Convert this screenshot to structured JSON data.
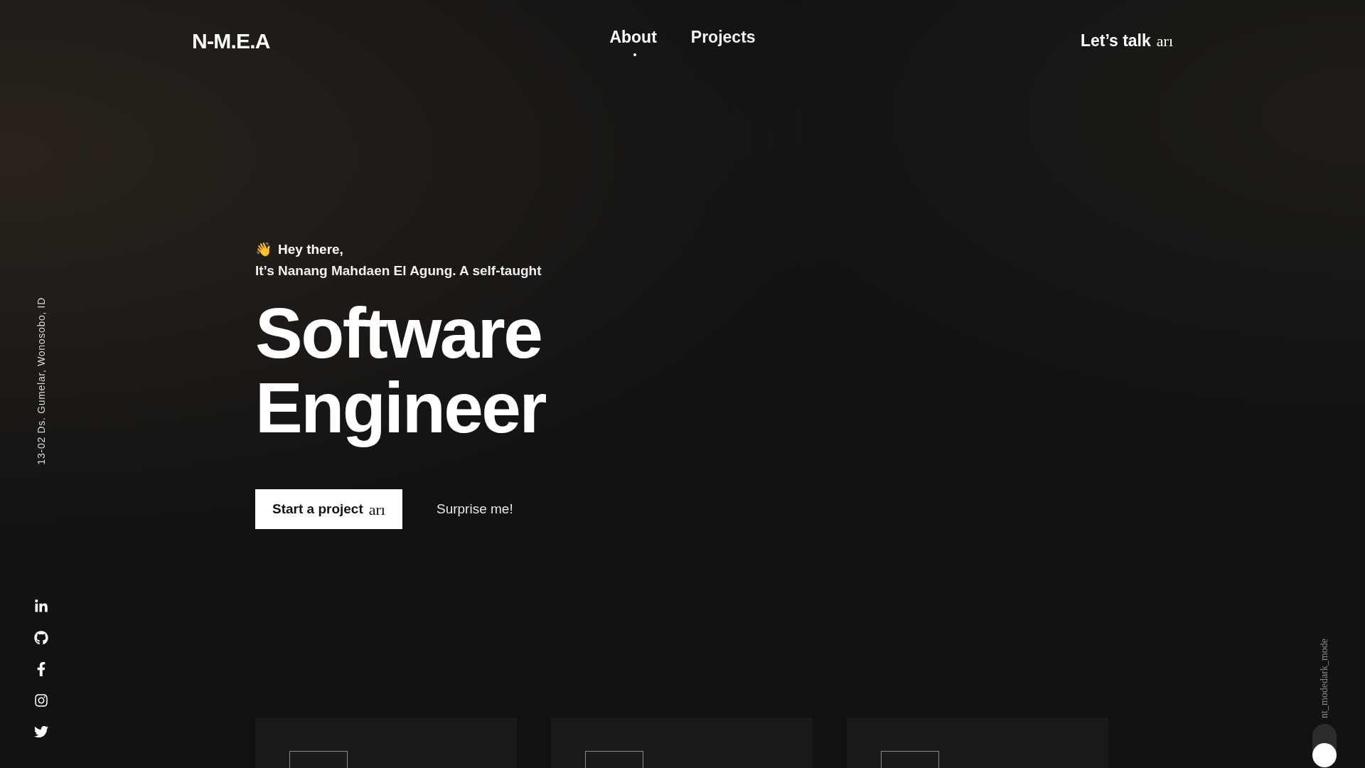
{
  "logo": "N-M.E.A",
  "nav": [
    {
      "label": "About",
      "selected": true
    },
    {
      "label": "Projects",
      "selected": false
    }
  ],
  "cta": {
    "label": "Let’s talk",
    "icon_text": "arı"
  },
  "address": "13-02 Ds. Gumelar, Wonosobo, ID",
  "socials": [
    {
      "kind": "linkedin"
    },
    {
      "kind": "github"
    },
    {
      "kind": "facebook"
    },
    {
      "kind": "instagram"
    },
    {
      "kind": "twitter"
    }
  ],
  "hero": {
    "wave_emoji": "👋",
    "greeting": "Hey there,",
    "intro": "It’s Nanang Mahdaen El Agung. A self-taught",
    "title_lines": [
      "Software",
      "Engineer"
    ],
    "primary_button": {
      "label": "Start a project",
      "icon_text": "arı"
    },
    "secondary_button": "Surprise me!"
  },
  "theme_toggle": {
    "labels": [
      "dark_mode",
      "nt_mode"
    ],
    "on": true
  },
  "cards": [
    {
      "kind": "card"
    },
    {
      "kind": "card"
    },
    {
      "kind": "card"
    }
  ]
}
